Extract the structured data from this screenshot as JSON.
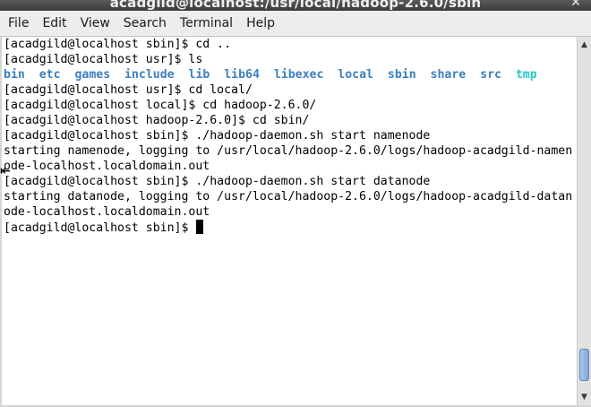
{
  "window": {
    "title": "acadgild@localhost:/usr/local/hadoop-2.6.0/sbin",
    "close_glyph": "✕"
  },
  "menu": {
    "items": [
      "File",
      "Edit",
      "View",
      "Search",
      "Terminal",
      "Help"
    ]
  },
  "terminal": {
    "lines": [
      "[acadgild@localhost sbin]$ cd ..",
      "[acadgild@localhost usr]$ ls",
      "",
      "[acadgild@localhost usr]$ cd local/",
      "[acadgild@localhost local]$ cd hadoop-2.6.0/",
      "[acadgild@localhost hadoop-2.6.0]$ cd sbin/",
      "[acadgild@localhost sbin]$ ./hadoop-daemon.sh start namenode",
      "starting namenode, logging to /usr/local/hadoop-2.6.0/logs/hadoop-acadgild-namen",
      "ode-localhost.localdomain.out",
      "[acadgild@localhost sbin]$ ./hadoop-daemon.sh start datanode",
      "starting datanode, logging to /usr/local/hadoop-2.6.0/logs/hadoop-acadgild-datan",
      "ode-localhost.localdomain.out",
      "[acadgild@localhost sbin]$ "
    ],
    "ls_dirs": [
      "bin",
      "etc",
      "games",
      "include",
      "lib",
      "lib64",
      "libexec",
      "local",
      "sbin",
      "share",
      "src"
    ],
    "ls_tmp": "tmp",
    "colors": {
      "dir": "#3c7fc0",
      "tmp_dir": "#27c6c6",
      "foreground": "#000000",
      "background": "#ffffff"
    }
  },
  "scrollbar": {
    "up_glyph": "▲",
    "down_glyph": "▼",
    "position": 0.97
  },
  "pointer": {
    "glyph": "⇤"
  }
}
